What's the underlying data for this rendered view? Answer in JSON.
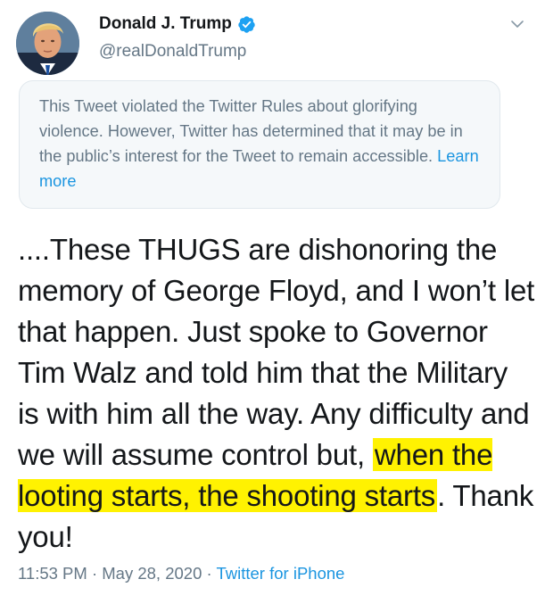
{
  "user": {
    "name": "Donald J. Trump",
    "handle": "@realDonaldTrump",
    "verified": true
  },
  "notice": {
    "text": "This Tweet violated the Twitter Rules about glorifying violence. However, Twitter has determined that it may be in the public’s interest for the Tweet to remain accessible.",
    "link": "Learn more"
  },
  "tweet": {
    "text_part1": "....These THUGS are dishonoring the memory of George Floyd, and I won’t let that happen. Just spoke to Governor Tim Walz and told him that the Military is with him all the way. Any difficulty and we will assume control but, ",
    "highlight": "when the looting starts, the shooting starts",
    "text_part2": ". Thank you!"
  },
  "meta": {
    "time": "11:53 PM",
    "sep1": " · ",
    "date": "May 28, 2020",
    "sep2": " · ",
    "source": "Twitter for iPhone"
  },
  "colors": {
    "link": "#1b95e0",
    "secondary": "#657786",
    "highlight": "#fff201",
    "verified_badge": "#1da1f2"
  },
  "icons": {
    "verified": "verified-badge-icon",
    "caret": "chevron-down-icon"
  }
}
